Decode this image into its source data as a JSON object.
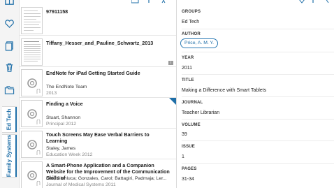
{
  "rail": {
    "tabs": [
      {
        "label": "Ed Tech"
      },
      {
        "label": "Family Systems"
      }
    ]
  },
  "list": {
    "items": [
      {
        "title": "97911158",
        "author": "",
        "meta": ""
      },
      {
        "title": "Tiffany_Hesser_and_Pauline_Schwartz_2013",
        "author": "",
        "meta": ""
      },
      {
        "title": "EndNote for iPad Getting Started Guide",
        "author": "The EndNote Team",
        "meta": "2013"
      },
      {
        "title": "Finding a Voice",
        "author": "Stuart, Shannon",
        "meta": "Principal 2012"
      },
      {
        "title": "Touch Screens May Ease Verbal Barriers to Learning",
        "author": "Staley, James",
        "meta": "Education Week 2012"
      },
      {
        "title": "A Smart-Phone Application and a Companion Website for the Improvement of the Communication Skills of",
        "author": "Leo, Gianluca; Gonzales, Carol; Battagiri, Padmaja; Ler...",
        "meta": "Journal of Medical Systems 2011"
      }
    ]
  },
  "detail": {
    "fields": [
      {
        "label": "GROUPS",
        "value": "Ed Tech"
      },
      {
        "label": "AUTHOR",
        "value": "Price, A. M. Y."
      },
      {
        "label": "YEAR",
        "value": "2011"
      },
      {
        "label": "TITLE",
        "value": "Making a Difference with Smart Tablets"
      },
      {
        "label": "JOURNAL",
        "value": "Teacher Librarian"
      },
      {
        "label": "VOLUME",
        "value": "39"
      },
      {
        "label": "ISSUE",
        "value": "1"
      },
      {
        "label": "PAGES",
        "value": "31-34"
      }
    ]
  },
  "colors": {
    "accent": "#1f6fa8"
  }
}
